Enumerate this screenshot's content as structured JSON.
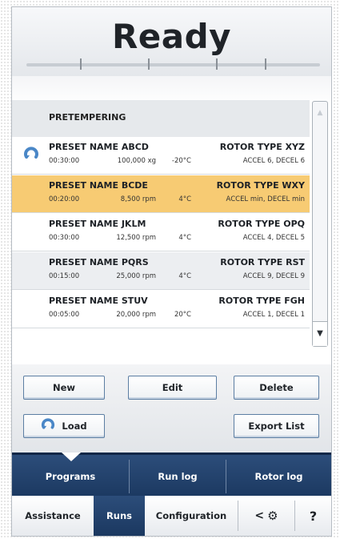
{
  "status": {
    "title": "Ready",
    "progress_ticks": 5
  },
  "list": {
    "header": "PRETEMPERING",
    "rows": [
      {
        "name": "PRESET NAME ABCD",
        "time": "00:30:00",
        "speed": "100,000 xg",
        "temp": "-20°C",
        "rotor": "ROTOR TYPE XYZ",
        "accel": "ACCEL 6, DECEL 6",
        "loaded": true,
        "state": "normal"
      },
      {
        "name": "PRESET NAME BCDE",
        "time": "00:20:00",
        "speed": "8,500 rpm",
        "temp": "4°C",
        "rotor": "ROTOR TYPE WXY",
        "accel": "ACCEL min, DECEL min",
        "loaded": false,
        "state": "selected"
      },
      {
        "name": "PRESET NAME JKLM",
        "time": "00:30:00",
        "speed": "12,500 rpm",
        "temp": "4°C",
        "rotor": "ROTOR TYPE OPQ",
        "accel": "ACCEL 4, DECEL 5",
        "loaded": false,
        "state": "normal"
      },
      {
        "name": "PRESET NAME PQRS",
        "time": "00:15:00",
        "speed": "25,000 rpm",
        "temp": "4°C",
        "rotor": "ROTOR TYPE RST",
        "accel": "ACCEL 9, DECEL 9",
        "loaded": false,
        "state": "alt"
      },
      {
        "name": "PRESET NAME STUV",
        "time": "00:05:00",
        "speed": "20,000 rpm",
        "temp": "20°C",
        "rotor": "ROTOR TYPE FGH",
        "accel": "ACCEL 1, DECEL 1",
        "loaded": false,
        "state": "normal"
      }
    ]
  },
  "actions": {
    "new_label": "New",
    "edit_label": "Edit",
    "delete_label": "Delete",
    "load_label": "Load",
    "export_label": "Export List"
  },
  "nav_primary": {
    "programs": "Programs",
    "run_log": "Run log",
    "rotor_log": "Rotor log"
  },
  "nav_secondary": {
    "assistance": "Assistance",
    "runs": "Runs",
    "configuration": "Configuration",
    "back_glyph": "<",
    "help_glyph": "?"
  },
  "colors": {
    "accent_blue": "#1b3860",
    "selected_row": "#f7cb73",
    "load_icon": "#4a87c7"
  },
  "icons": {
    "load": "refresh-icon",
    "settings": "gear-icon",
    "back": "chevron-left-icon",
    "help": "question-icon",
    "scroll_up": "chevron-up-icon",
    "scroll_down": "chevron-down-icon"
  }
}
